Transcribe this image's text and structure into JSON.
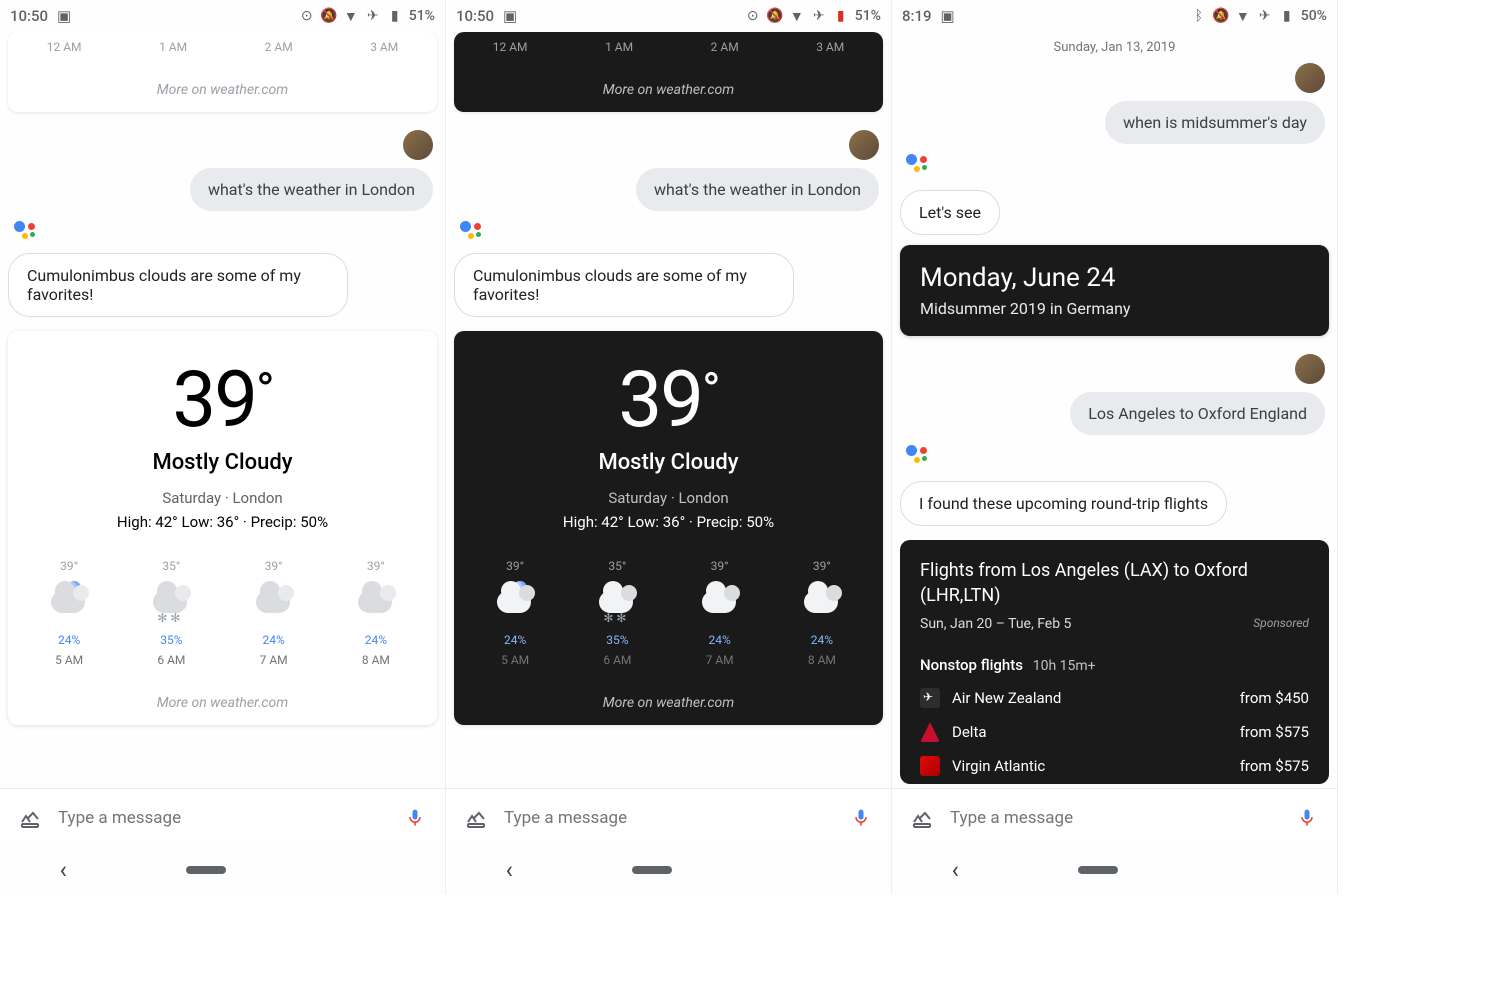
{
  "screens": [
    {
      "status": {
        "time": "10:50",
        "battery": "51%"
      },
      "top_times": [
        "12 AM",
        "1 AM",
        "2 AM",
        "3 AM"
      ],
      "top_more": "More on weather.com",
      "user_msg": "what's the weather in London",
      "asst_msg": "Cumulonimbus clouds are some of my favorites!",
      "weather": {
        "temp": "39",
        "condition": "Mostly Cloudy",
        "location": "Saturday · London",
        "stats": "High: 42° Low: 36° · Precip: 50%",
        "forecast": [
          {
            "temp": "39°",
            "pct": "24%",
            "time": "5 AM",
            "moon": true
          },
          {
            "temp": "35°",
            "pct": "35%",
            "time": "6 AM",
            "snow": true
          },
          {
            "temp": "39°",
            "pct": "24%",
            "time": "7 AM"
          },
          {
            "temp": "39°",
            "pct": "24%",
            "time": "8 AM"
          }
        ],
        "more": "More on weather.com"
      },
      "dark_top": false,
      "dark_card": false
    },
    {
      "status": {
        "time": "10:50",
        "battery": "51%"
      },
      "top_times": [
        "12 AM",
        "1 AM",
        "2 AM",
        "3 AM"
      ],
      "top_more": "More on weather.com",
      "user_msg": "what's the weather in London",
      "asst_msg": "Cumulonimbus clouds are some of my favorites!",
      "weather": {
        "temp": "39",
        "condition": "Mostly Cloudy",
        "location": "Saturday · London",
        "stats": "High: 42° Low: 36° · Precip: 50%",
        "forecast": [
          {
            "temp": "39°",
            "pct": "24%",
            "time": "5 AM",
            "moon": true
          },
          {
            "temp": "35°",
            "pct": "35%",
            "time": "6 AM",
            "snow": true
          },
          {
            "temp": "39°",
            "pct": "24%",
            "time": "7 AM"
          },
          {
            "temp": "39°",
            "pct": "24%",
            "time": "8 AM"
          }
        ],
        "more": "More on weather.com"
      },
      "dark_top": true,
      "dark_card": true
    }
  ],
  "screen3": {
    "status": {
      "time": "8:19",
      "battery": "50%"
    },
    "date": "Sunday, Jan 13, 2019",
    "user_msg1": "when is midsummer's day",
    "asst_msg1": "Let's see",
    "card1": {
      "title": "Monday, June 24",
      "sub": "Midsummer 2019 in Germany"
    },
    "user_msg2": "Los Angeles to Oxford England",
    "asst_msg2": "I found these upcoming round-trip flights",
    "flights": {
      "title": "Flights from Los Angeles (LAX) to Oxford (LHR,LTN)",
      "dates": "Sun, Jan 20 – Tue, Feb 5",
      "sponsored": "Sponsored",
      "section": "Nonstop flights",
      "duration": "10h 15m+",
      "rows": [
        {
          "airline": "Air New Zealand",
          "price": "from $450"
        },
        {
          "airline": "Delta",
          "price": "from $575"
        },
        {
          "airline": "Virgin Atlantic",
          "price": "from $575"
        }
      ]
    }
  },
  "input_placeholder": "Type a message"
}
